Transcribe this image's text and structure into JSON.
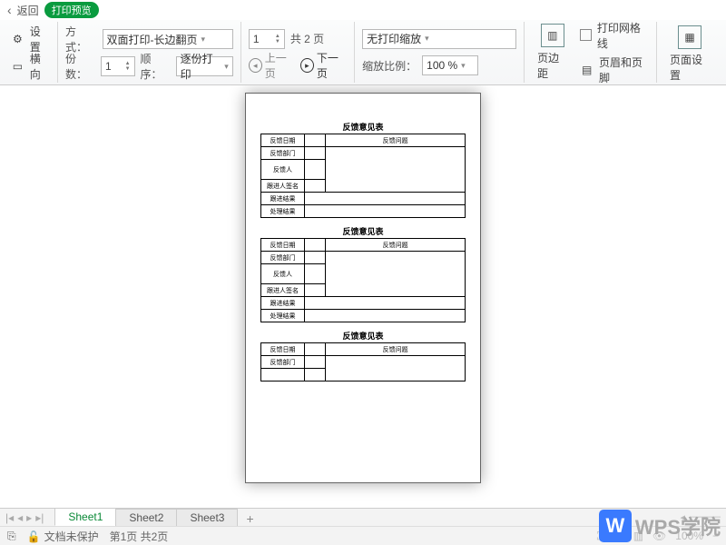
{
  "topbar": {
    "back": "返回",
    "preview": "打印预览"
  },
  "ribbon": {
    "settings": "设置",
    "landscape": "横向",
    "mode": "方式：",
    "mode_val": "双面打印-长边翻页",
    "copies": "份数：",
    "copies_val": "1",
    "order": "顺序：",
    "order_val": "逐份打印",
    "page_val": "1",
    "page_total": "共 2 页",
    "prev": "上一页",
    "next": "下一页",
    "zoom_mode": "无打印缩放",
    "zoom_lbl": "缩放比例：",
    "zoom_val": "100 %",
    "margins": "页边距",
    "gridlines": "打印网格线",
    "headerfooter": "页眉和页脚",
    "page_setup": "页面设置"
  },
  "form": {
    "title": "反馈意见表",
    "rows": [
      "反馈日期",
      "反馈部门",
      "反馈人",
      "跟进人签名",
      "跟进结果",
      "处理结果"
    ],
    "col2": "反馈问题"
  },
  "tabs": {
    "s1": "Sheet1",
    "s2": "Sheet2",
    "s3": "Sheet3",
    "add": "+"
  },
  "status": {
    "protect": "文档未保护",
    "pages": "第1页 共2页",
    "zoom": "100%"
  },
  "logo": {
    "w": "W",
    "text": "WPS学院"
  }
}
